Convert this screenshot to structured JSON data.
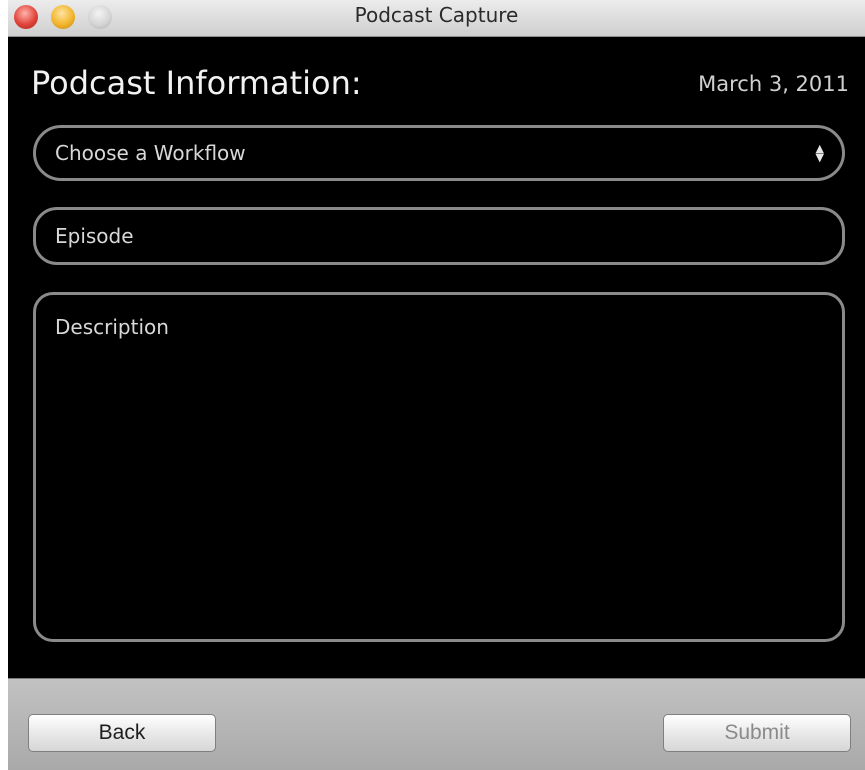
{
  "window": {
    "title": "Podcast Capture"
  },
  "form": {
    "heading": "Podcast Information:",
    "date": "March 3, 2011",
    "workflow_select": {
      "selected": "Choose a Workflow",
      "icon": "up-down-arrows-icon"
    },
    "episode_placeholder": "Episode",
    "description_placeholder": "Description"
  },
  "footer": {
    "back_label": "Back",
    "submit_label": "Submit",
    "submit_enabled": false
  },
  "colors": {
    "background": "#000000",
    "field_border": "#8a8a8a",
    "bar": "#b4b4b4",
    "close": "#e0443a",
    "minimize": "#f2b52c",
    "zoom": "#d2d2d2"
  }
}
